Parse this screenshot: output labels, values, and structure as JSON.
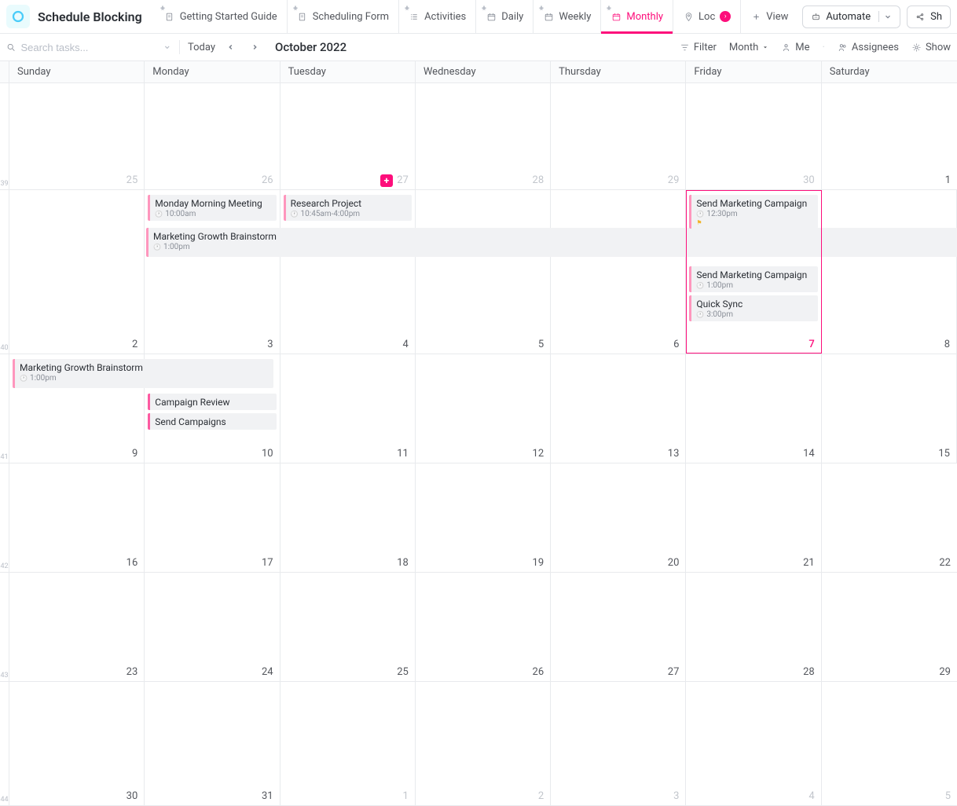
{
  "header": {
    "workspace": "Schedule Blocking",
    "tabs": [
      {
        "label": "Getting Started Guide",
        "icon": "doc-icon"
      },
      {
        "label": "Scheduling Form",
        "icon": "doc-icon"
      },
      {
        "label": "Activities",
        "icon": "list-icon"
      },
      {
        "label": "Daily",
        "icon": "calendar-icon"
      },
      {
        "label": "Weekly",
        "icon": "calendar-icon"
      },
      {
        "label": "Monthly",
        "icon": "calendar-icon",
        "active": true
      },
      {
        "label": "Loc",
        "icon": "location-icon",
        "overflow": true
      },
      {
        "label": "View",
        "icon": "plus-icon"
      }
    ],
    "automate": "Automate",
    "share_partial": "Sh"
  },
  "toolbar": {
    "search_placeholder": "Search tasks...",
    "today": "Today",
    "month_label": "October 2022",
    "filter": "Filter",
    "period": "Month",
    "me": "Me",
    "assignees": "Assignees",
    "show": "Show"
  },
  "calendar": {
    "day_headers": [
      "Sunday",
      "Monday",
      "Tuesday",
      "Wednesday",
      "Thursday",
      "Friday",
      "Saturday"
    ],
    "week_numbers": [
      "39",
      "40",
      "41",
      "42",
      "43",
      "44"
    ],
    "weeks": [
      [
        {
          "n": "25",
          "muted": true
        },
        {
          "n": "26",
          "muted": true
        },
        {
          "n": "27",
          "muted": true,
          "plus": true
        },
        {
          "n": "28",
          "muted": true
        },
        {
          "n": "29",
          "muted": true
        },
        {
          "n": "30",
          "muted": true
        },
        {
          "n": "1"
        }
      ],
      [
        {
          "n": "2"
        },
        {
          "n": "3",
          "events": [
            {
              "title": "Monday Morning Meeting",
              "time": "10:00am"
            }
          ]
        },
        {
          "n": "4",
          "events": [
            {
              "title": "Research Project",
              "time": "10:45am-4:00pm"
            }
          ]
        },
        {
          "n": "5"
        },
        {
          "n": "6"
        },
        {
          "n": "7",
          "today": true,
          "events": [
            {
              "title": "Send Marketing Campaign",
              "time": "12:30pm",
              "flag": true
            },
            {
              "spacer": true
            },
            {
              "title": "Send Marketing Campaign",
              "time": "1:00pm"
            },
            {
              "title": "Quick Sync",
              "time": "3:00pm"
            }
          ]
        },
        {
          "n": "8"
        }
      ],
      [
        {
          "n": "9"
        },
        {
          "n": "10",
          "events": [
            {
              "spacer": true
            },
            {
              "title": "Campaign Review",
              "dark": true
            },
            {
              "title": "Send Campaigns",
              "dark": true
            }
          ]
        },
        {
          "n": "11"
        },
        {
          "n": "12"
        },
        {
          "n": "13"
        },
        {
          "n": "14"
        },
        {
          "n": "15"
        }
      ],
      [
        {
          "n": "16"
        },
        {
          "n": "17"
        },
        {
          "n": "18"
        },
        {
          "n": "19"
        },
        {
          "n": "20"
        },
        {
          "n": "21"
        },
        {
          "n": "22"
        }
      ],
      [
        {
          "n": "23"
        },
        {
          "n": "24"
        },
        {
          "n": "25"
        },
        {
          "n": "26"
        },
        {
          "n": "27"
        },
        {
          "n": "28"
        },
        {
          "n": "29"
        }
      ],
      [
        {
          "n": "30"
        },
        {
          "n": "31"
        },
        {
          "n": "1",
          "muted": true
        },
        {
          "n": "2",
          "muted": true
        },
        {
          "n": "3",
          "muted": true
        },
        {
          "n": "4",
          "muted": true
        },
        {
          "n": "5",
          "muted": true
        }
      ]
    ],
    "span_events": [
      {
        "week": 1,
        "title": "Marketing Growth Brainstorm",
        "time": "1:00pm"
      },
      {
        "week": 2,
        "title": "Marketing Growth Brainstorm",
        "time": "1:00pm",
        "cls": "w3"
      }
    ]
  }
}
